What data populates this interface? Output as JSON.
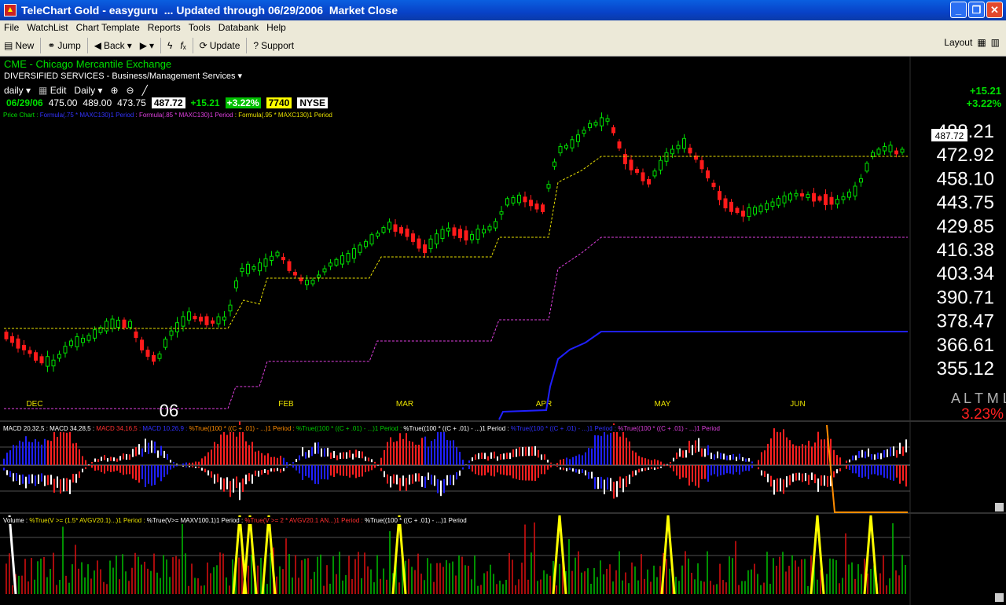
{
  "window": {
    "title": "TeleChart Gold - easyguru  ... Updated through 06/29/2006  Market Close",
    "min": "_",
    "max": "❐",
    "close": "✕"
  },
  "menu": [
    "File",
    "WatchList",
    "Chart Template",
    "Reports",
    "Tools",
    "Databank",
    "Help"
  ],
  "toolbar": {
    "new": "New",
    "jump": "Jump",
    "back": "Back",
    "update": "Update",
    "support": "Support",
    "layout": "Layout"
  },
  "header": {
    "symbol_line": "CME - Chicago Mercantile Exchange",
    "industry": "DIVERSIFIED SERVICES - Business/Management Services",
    "period": "daily",
    "edit": "Edit",
    "interval": "Daily",
    "date": "06/29/06",
    "open": "475.00",
    "high": "489.00",
    "low": "473.75",
    "close": "487.72",
    "change": "+15.21",
    "pct": "+3.22%",
    "vol": "7740",
    "exchange": "NYSE",
    "right_change": "+15.21",
    "right_pct": "+3.22%",
    "price_legend": [
      {
        "text": "Price Chart :",
        "color": "#00e000"
      },
      {
        "text": "Formula(.75 * MAXC130)1 Period",
        "color": "#3333ff"
      },
      {
        "text": ": Formula(.85 * MAXC130)1 Period",
        "color": "#e040e0"
      },
      {
        "text": ": Formula(.95 * MAXC130)1 Period",
        "color": "#e8e000"
      }
    ]
  },
  "price_axis": {
    "labels": [
      "488.21",
      "472.92",
      "458.10",
      "443.75",
      "429.85",
      "416.38",
      "403.34",
      "390.71",
      "378.47",
      "366.61",
      "355.12"
    ],
    "current": "487.72",
    "altml": "A L T M L",
    "pct_badge": "3.23%"
  },
  "months": [
    "DEC",
    "FEB",
    "MAR",
    "APR",
    "MAY",
    "JUN"
  ],
  "year_label": "06",
  "macd": {
    "legend": [
      {
        "text": "MACD 20,32,5 :",
        "color": "#fff"
      },
      {
        "text": "MACD 34,28,5 :",
        "color": "#fff"
      },
      {
        "text": "MACD 34,16,5 :",
        "color": "#ff3030"
      },
      {
        "text": "MACD 10,26,9 :",
        "color": "#3030ff"
      },
      {
        "text": "%True((100 * ((C + .01) - ...)1 Period :",
        "color": "#ff8c00"
      },
      {
        "text": "%True((100 * ((C + .01) - ...)1 Period :",
        "color": "#00d000"
      },
      {
        "text": "%True((100 * ((C + .01) - ...)1 Period :",
        "color": "#fff"
      },
      {
        "text": "%True((100 * ((C + .01) - ...)1 Period :",
        "color": "#3030ff"
      },
      {
        "text": "%True((100 * ((C + .01) - ...)1 Period",
        "color": "#e040e0"
      }
    ],
    "axis": [
      "1.85",
      "0.00",
      "-1.85"
    ]
  },
  "volume": {
    "legend": [
      {
        "text": "Volume :",
        "color": "#fff"
      },
      {
        "text": "%True(V >= (1.5* AVGV20.1)...)1 Period :",
        "color": "#e8e000"
      },
      {
        "text": "%True(V>= MAXV100.1)1 Period :",
        "color": "#fff"
      },
      {
        "text": "%True(V >= 2 * AVGV20.1 AN...)1 Period :",
        "color": "#ff3030"
      },
      {
        "text": "%True((100 * ((C + .01) - ...)1 Period",
        "color": "#fff"
      }
    ],
    "axis": [
      "19775",
      "9888",
      "0"
    ]
  },
  "colors": {
    "up": "#00e000",
    "down": "#ff1a1a",
    "ma75": "#2020ff",
    "ma85": "#e040e0",
    "ma95": "#e8e000"
  }
}
